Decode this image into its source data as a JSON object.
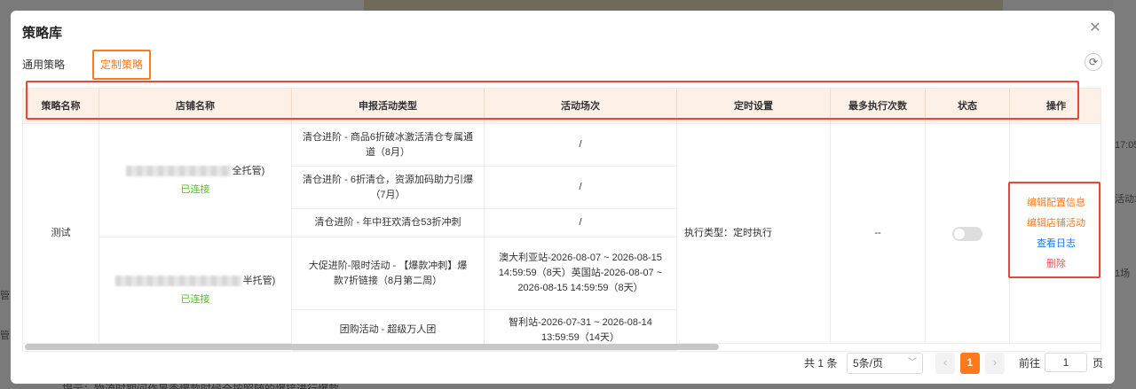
{
  "background": {
    "right_texts": [
      "17:05",
      "活动场",
      "1场"
    ],
    "left_texts": [
      "管",
      "管"
    ],
    "bottom_text": "提示：物流时期间作暑季爆款时候全按照随的爆接进行爆款"
  },
  "modal": {
    "title": "策略库",
    "close_icon": "close-icon",
    "refresh_icon": "refresh-icon",
    "tabs": [
      {
        "label": "通用策略",
        "active": false
      },
      {
        "label": "定制策略",
        "active": true
      }
    ],
    "table": {
      "columns": [
        "策略名称",
        "店铺名称",
        "申报活动类型",
        "活动场次",
        "定时设置",
        "最多执行次数",
        "状态",
        "操作"
      ],
      "row": {
        "strategy_name": "测试",
        "shops": [
          {
            "name_suffix": "全托管)",
            "status": "已连接",
            "activities": [
              {
                "type": "清仓进阶 - 商品6折破冰激活清仓专属通道（8月）",
                "session": "/"
              },
              {
                "type": "清仓进阶 - 6折清仓，资源加码助力引爆（7月）",
                "session": "/"
              },
              {
                "type": "清仓进阶 - 年中狂欢清仓53折冲刺",
                "session": "/"
              }
            ]
          },
          {
            "name_suffix": "半托管)",
            "status": "已连接",
            "activities": [
              {
                "type": "大促进阶-限时活动 - 【爆款冲刺】爆款7折链接（8月第二周）",
                "session": "澳大利亚站-2026-08-07 ~ 2026-08-15 14:59:59（8天）英国站-2026-08-07 ~ 2026-08-15 14:59:59（8天）"
              },
              {
                "type": "团购活动 - 超级万人团",
                "session": "智利站-2026-07-31 ~ 2026-08-14 13:59:59（14天）"
              }
            ]
          }
        ],
        "schedule": "执行类型：定时执行",
        "max_runs": "--",
        "status_toggle_on": false,
        "actions": [
          {
            "label": "编辑配置信息",
            "color": "#ff7a1a"
          },
          {
            "label": "编辑店铺活动",
            "color": "#ff7a1a"
          },
          {
            "label": "查看日志",
            "color": "#1677ff"
          },
          {
            "label": "删除",
            "color": "#ff4d4f"
          }
        ]
      }
    },
    "pagination": {
      "total": "共 1 条",
      "page_size": "5条/页",
      "current_page": "1",
      "goto_label": "前往",
      "goto_value": "1",
      "goto_unit": "页"
    }
  },
  "colors": {
    "accent": "#ff7a1a",
    "highlight": "#e8473d",
    "header_bg": "#fdf0e6",
    "success": "#52c41a"
  }
}
